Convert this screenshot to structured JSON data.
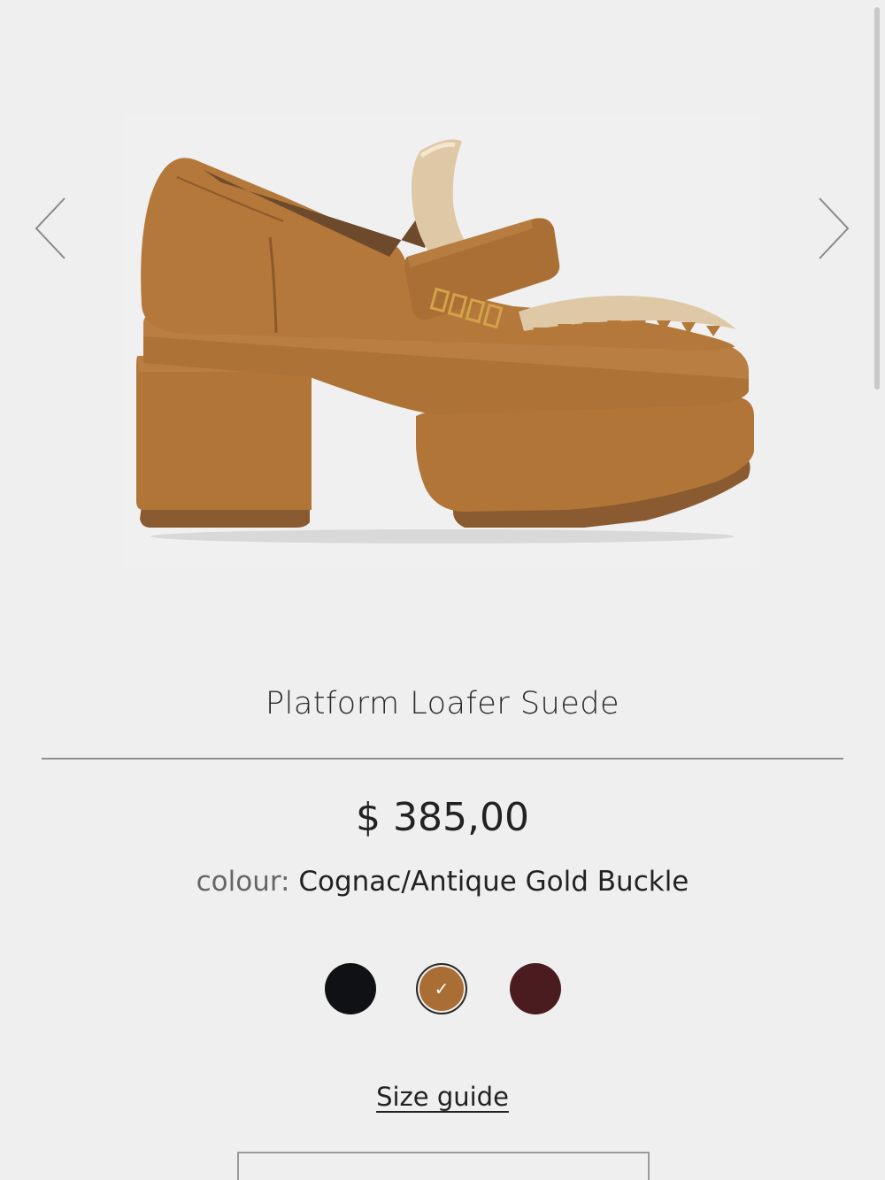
{
  "gallery": {
    "prev_icon": "chevron-left-icon",
    "next_icon": "chevron-right-icon",
    "image_alt": "Platform Loafer Suede"
  },
  "product": {
    "title": "Platform Loafer Suede",
    "price": "$ 385,00",
    "colour_label": "colour:",
    "colour_value": "Cognac/Antique Gold Buckle"
  },
  "swatches": [
    {
      "name": "black",
      "color": "#0f1115",
      "selected": false
    },
    {
      "name": "cognac",
      "color": "#a86e33",
      "selected": true
    },
    {
      "name": "burgundy",
      "color": "#4a1c20",
      "selected": false
    }
  ],
  "size_guide": {
    "label": "Size guide"
  }
}
